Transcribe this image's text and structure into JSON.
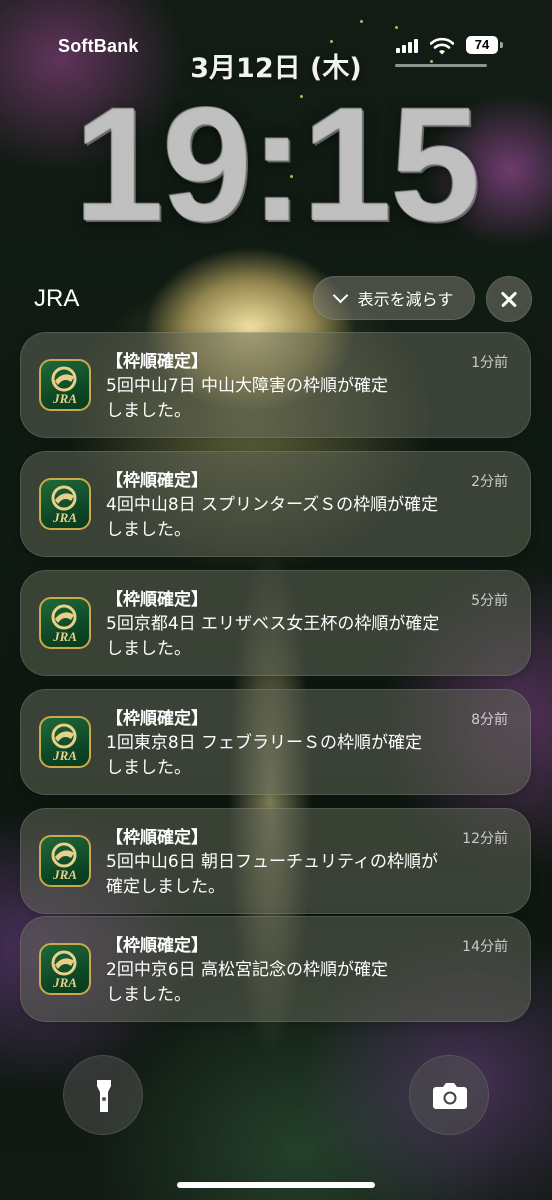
{
  "status_bar": {
    "carrier": "SoftBank",
    "battery": "74"
  },
  "lock_screen": {
    "date": "3月12日 (木)",
    "time": "19:15"
  },
  "notification_group": {
    "app": "JRA",
    "show_less_label": "表示を減らす",
    "icon_text": "JRA",
    "accent_color": "#c9a94a",
    "items": [
      {
        "title": "【枠順確定】",
        "time": "1分前",
        "body": "5回中山7日 中山大障害の枠順が確定\nしました。"
      },
      {
        "title": "【枠順確定】",
        "time": "2分前",
        "body": "4回中山8日 スプリンターズＳの枠順が確定\nしました。"
      },
      {
        "title": "【枠順確定】",
        "time": "5分前",
        "body": "5回京都4日 エリザベス女王杯の枠順が確定\nしました。"
      },
      {
        "title": "【枠順確定】",
        "time": "8分前",
        "body": "1回東京8日 フェブラリーＳの枠順が確定\nしました。"
      },
      {
        "title": "【枠順確定】",
        "time": "12分前",
        "body": "5回中山6日 朝日フューチュリティの枠順が\n確定しました。"
      },
      {
        "title": "【枠順確定】",
        "time": "14分前",
        "body": "2回中京6日 高松宮記念の枠順が確定\nしました。"
      }
    ]
  },
  "quick_actions": {
    "left_icon": "flashlight-icon",
    "right_icon": "camera-icon"
  }
}
